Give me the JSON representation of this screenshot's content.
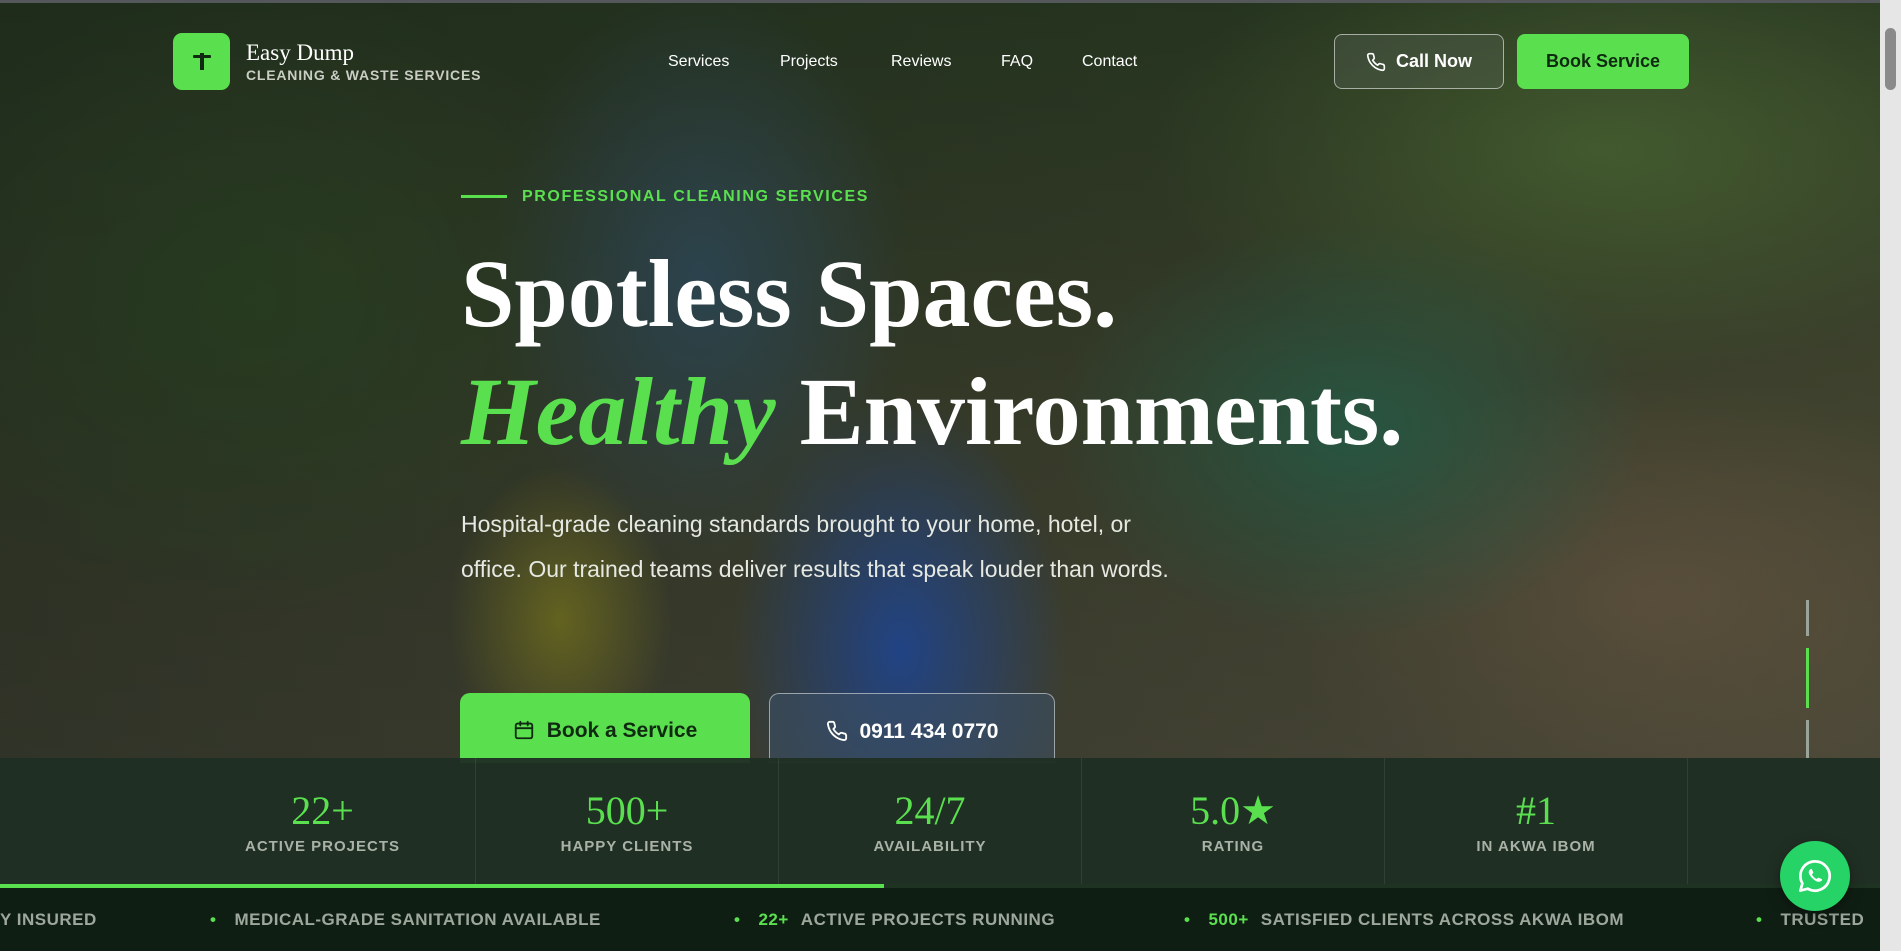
{
  "brand": {
    "name": "Easy Dump",
    "tagline": "CLEANING & WASTE SERVICES",
    "logo_icon": "trash-bin-icon",
    "accent_color": "#5ae04f"
  },
  "nav": {
    "items": [
      "Services",
      "Projects",
      "Reviews",
      "FAQ",
      "Contact"
    ]
  },
  "header": {
    "call_label": "Call Now",
    "book_label": "Book Service"
  },
  "hero": {
    "eyebrow": "PROFESSIONAL CLEANING SERVICES",
    "headline_line1": "Spotless Spaces.",
    "headline_accent": "Healthy",
    "headline_line2_rest": "Environments.",
    "lead": "Hospital-grade cleaning standards brought to your home, hotel, or office. Our trained teams deliver results that speak louder than words.",
    "cta_primary": "Book a Service",
    "cta_phone": "0911 434 0770",
    "slider": {
      "slides": 3,
      "active": 2
    }
  },
  "stats": [
    {
      "value": "22+",
      "label": "ACTIVE PROJECTS"
    },
    {
      "value": "500+",
      "label": "HAPPY CLIENTS"
    },
    {
      "value": "24/7",
      "label": "AVAILABILITY"
    },
    {
      "value": "5.0★",
      "label": "RATING"
    },
    {
      "value": "#1",
      "label": "IN AKWA IBOM"
    }
  ],
  "stats_progress": 0.47,
  "ticker": [
    {
      "num": "",
      "text": "Y INSURED",
      "dot": false
    },
    {
      "num": "",
      "text": "MEDICAL-GRADE SANITATION AVAILABLE",
      "dot": true
    },
    {
      "num": "22+",
      "text": "ACTIVE PROJECTS RUNNING",
      "dot": true
    },
    {
      "num": "500+",
      "text": "SATISFIED CLIENTS ACROSS AKWA IBOM",
      "dot": true
    },
    {
      "num": "",
      "text": "TRUSTED",
      "dot": true
    }
  ],
  "floating": {
    "whatsapp_icon": "whatsapp-icon"
  }
}
